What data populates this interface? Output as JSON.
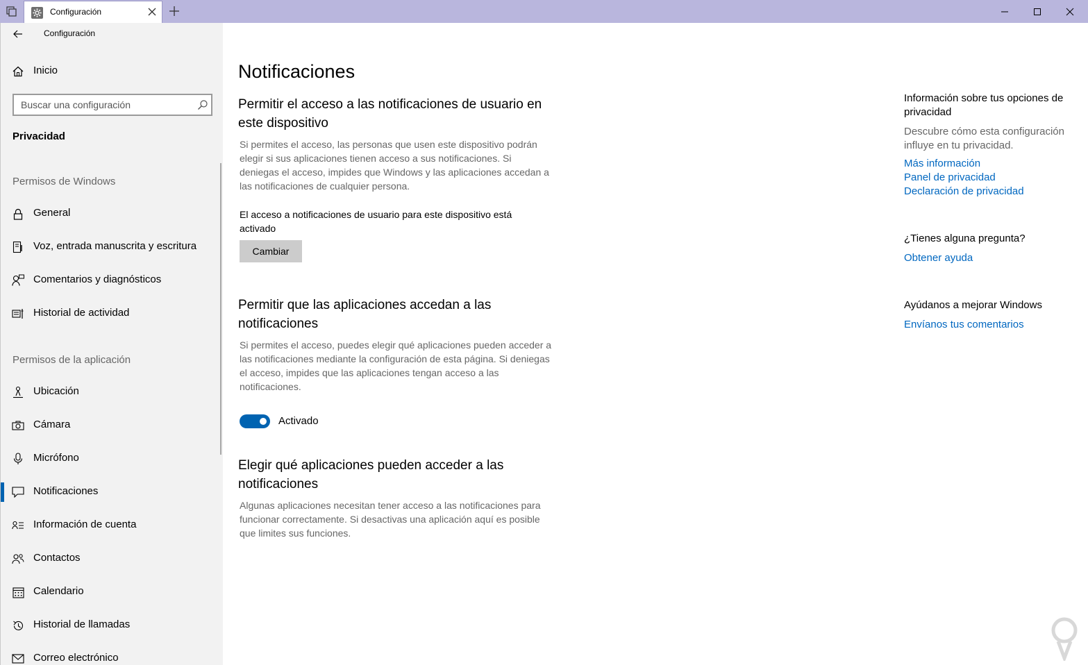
{
  "window": {
    "tab_title": "Configuración",
    "app_title": "Configuración"
  },
  "sidebar": {
    "home_label": "Inicio",
    "search_placeholder": "Buscar una configuración",
    "current_category": "Privacidad",
    "windows_permissions_header": "Permisos de Windows",
    "windows_items": [
      {
        "label": "General",
        "icon": "lock-icon"
      },
      {
        "label": "Voz, entrada manuscrita y escritura",
        "icon": "document-pen-icon"
      },
      {
        "label": "Comentarios y diagnósticos",
        "icon": "feedback-person-icon"
      },
      {
        "label": "Historial de actividad",
        "icon": "activity-history-icon"
      }
    ],
    "app_permissions_header": "Permisos de la aplicación",
    "app_items": [
      {
        "label": "Ubicación",
        "icon": "location-icon"
      },
      {
        "label": "Cámara",
        "icon": "camera-icon"
      },
      {
        "label": "Micrófono",
        "icon": "microphone-icon"
      },
      {
        "label": "Notificaciones",
        "icon": "notification-icon",
        "active": true
      },
      {
        "label": "Información de cuenta",
        "icon": "account-info-icon"
      },
      {
        "label": "Contactos",
        "icon": "contacts-icon"
      },
      {
        "label": "Calendario",
        "icon": "calendar-icon"
      },
      {
        "label": "Historial de llamadas",
        "icon": "call-history-icon"
      },
      {
        "label": "Correo electrónico",
        "icon": "mail-icon"
      }
    ]
  },
  "main": {
    "title": "Notificaciones",
    "section1": {
      "title": "Permitir el acceso a las notificaciones de usuario en este dispositivo",
      "description": "Si permites el acceso, las personas que usen este dispositivo podrán elegir si sus aplicaciones tienen acceso a sus notificaciones. Si deniegas el acceso, impides que Windows y las aplicaciones accedan a las notificaciones de cualquier persona.",
      "status": "El acceso a notificaciones de usuario para este dispositivo está activado",
      "button_label": "Cambiar"
    },
    "section2": {
      "title": "Permitir que las aplicaciones accedan a las notificaciones",
      "description": "Si permites el acceso, puedes elegir qué aplicaciones pueden acceder a las notificaciones mediante la configuración de esta página. Si deniegas el acceso, impides que las aplicaciones tengan acceso a las notificaciones.",
      "toggle_label": "Activado",
      "toggle_on": true
    },
    "section3": {
      "title": "Elegir qué aplicaciones pueden acceder a las notificaciones",
      "description": "Algunas aplicaciones necesitan tener acceso a las notificaciones para funcionar correctamente. Si desactivas una aplicación aquí es posible que limites sus funciones."
    }
  },
  "right": {
    "privacy_header": "Información sobre tus opciones de privacidad",
    "privacy_desc": "Descubre cómo esta configuración influye en tu privacidad.",
    "links": [
      "Más información",
      "Panel de privacidad",
      "Declaración de privacidad"
    ],
    "question_header": "¿Tienes alguna pregunta?",
    "help_link": "Obtener ayuda",
    "improve_header": "Ayúdanos a mejorar Windows",
    "feedback_link": "Envíanos tus comentarios"
  },
  "colors": {
    "accent": "#0063b1",
    "link": "#0067c0",
    "titlebar": "#b9b6dd",
    "sidebar_bg": "#f2f2f2"
  }
}
